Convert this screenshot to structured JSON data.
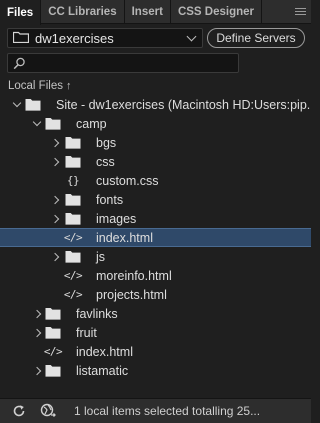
{
  "tabs": [
    {
      "label": "Files"
    },
    {
      "label": "CC Libraries"
    },
    {
      "label": "Insert"
    },
    {
      "label": "CSS Designer"
    }
  ],
  "site_select": {
    "value": "dw1exercises"
  },
  "define_servers_label": "Define Servers",
  "search": {
    "placeholder": ""
  },
  "local_files": {
    "label": "Local Files",
    "sort_arrow": "↑"
  },
  "tree": [
    {
      "label": "Site - dw1exercises (Macintosh HD:Users:pip...",
      "icon": "folder-icon",
      "expand": "down"
    },
    {
      "label": "camp",
      "icon": "folder-icon",
      "expand": "down"
    },
    {
      "label": "bgs",
      "icon": "folder-icon",
      "expand": "right"
    },
    {
      "label": "css",
      "icon": "folder-icon",
      "expand": "right"
    },
    {
      "label": "custom.css",
      "icon": "css-file-icon",
      "expand": "none"
    },
    {
      "label": "fonts",
      "icon": "folder-icon",
      "expand": "right"
    },
    {
      "label": "images",
      "icon": "folder-icon",
      "expand": "right"
    },
    {
      "label": "index.html",
      "icon": "html-file-icon",
      "expand": "none",
      "selected": true
    },
    {
      "label": "js",
      "icon": "folder-icon",
      "expand": "right"
    },
    {
      "label": "moreinfo.html",
      "icon": "html-file-icon",
      "expand": "none"
    },
    {
      "label": "projects.html",
      "icon": "html-file-icon",
      "expand": "none"
    },
    {
      "label": "favlinks",
      "icon": "folder-icon",
      "expand": "right"
    },
    {
      "label": "fruit",
      "icon": "folder-icon",
      "expand": "right"
    },
    {
      "label": "index.html",
      "icon": "html-file-icon",
      "expand": "none"
    },
    {
      "label": "listamatic",
      "icon": "folder-icon",
      "expand": "right"
    }
  ],
  "status": {
    "text": "1 local items selected totalling 25..."
  },
  "glyphs": {
    "css": "{}",
    "html": "</>"
  },
  "colors": {
    "selection": "#2f4969",
    "background": "#1f1f1f",
    "tab_bar": "#2d2d2d"
  }
}
